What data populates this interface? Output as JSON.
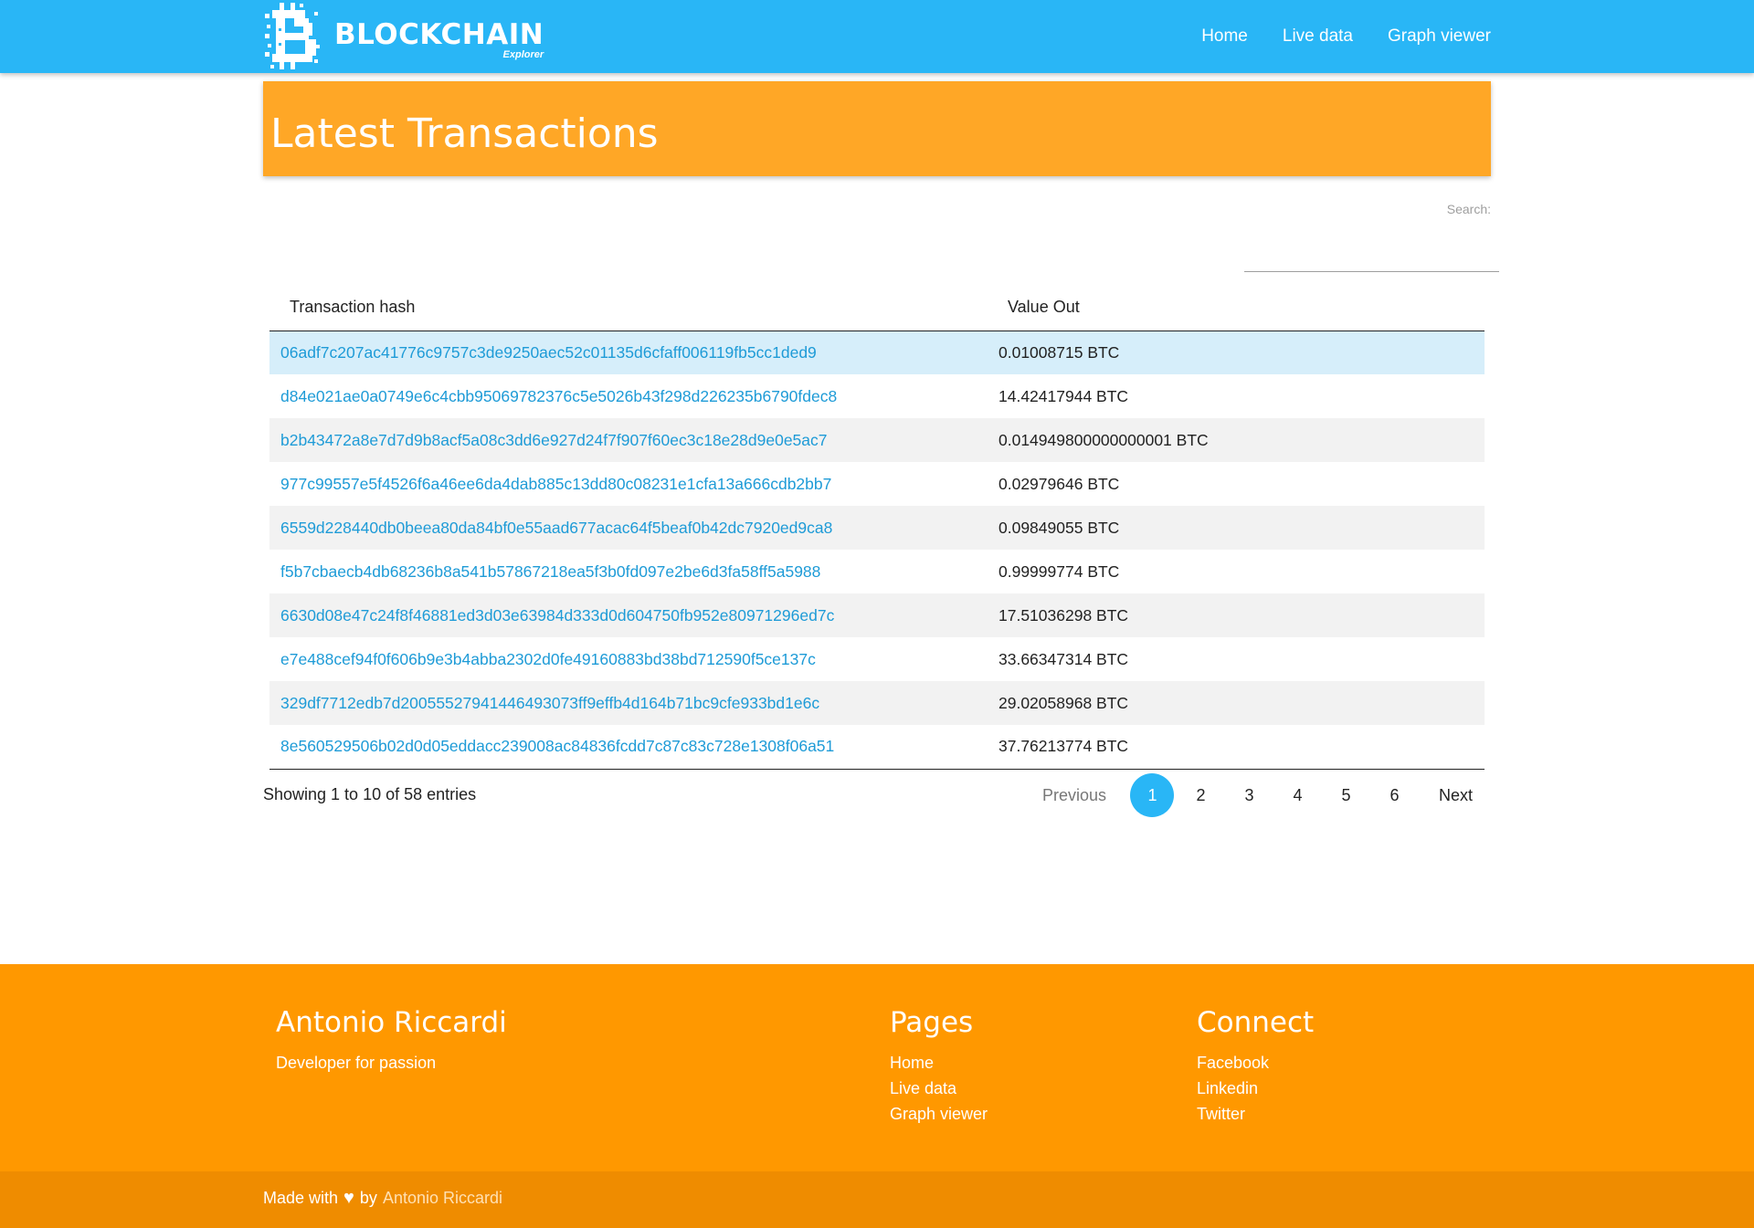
{
  "header": {
    "brand_title": "BLOCKCHAIN",
    "brand_subtitle": "Explorer",
    "nav": [
      "Home",
      "Live data",
      "Graph viewer"
    ]
  },
  "page": {
    "title": "Latest Transactions",
    "search_label": "Search:",
    "search_value": ""
  },
  "table": {
    "columns": [
      "Transaction hash",
      "Value Out"
    ],
    "rows": [
      {
        "hash": "06adf7c207ac41776c9757c3de9250aec52c01135d6cfaff006119fb5cc1ded9",
        "value": "0.01008715 BTC"
      },
      {
        "hash": "d84e021ae0a0749e6c4cbb95069782376c5e5026b43f298d226235b6790fdec8",
        "value": "14.42417944 BTC"
      },
      {
        "hash": "b2b43472a8e7d7d9b8acf5a08c3dd6e927d24f7f907f60ec3c18e28d9e0e5ac7",
        "value": "0.014949800000000001 BTC"
      },
      {
        "hash": "977c99557e5f4526f6a46ee6da4dab885c13dd80c08231e1cfa13a666cdb2bb7",
        "value": "0.02979646 BTC"
      },
      {
        "hash": "6559d228440db0beea80da84bf0e55aad677acac64f5beaf0b42dc7920ed9ca8",
        "value": "0.09849055 BTC"
      },
      {
        "hash": "f5b7cbaecb4db68236b8a541b57867218ea5f3b0fd097e2be6d3fa58ff5a5988",
        "value": "0.99999774 BTC"
      },
      {
        "hash": "6630d08e47c24f8f46881ed3d03e63984d333d0d604750fb952e80971296ed7c",
        "value": "17.51036298 BTC"
      },
      {
        "hash": "e7e488cef94f0f606b9e3b4abba2302d0fe49160883bd38bd712590f5ce137c",
        "value": "33.66347314 BTC"
      },
      {
        "hash": "329df7712edb7d20055527941446493073ff9effb4d164b71bc9cfe933bd1e6c",
        "value": "29.02058968 BTC"
      },
      {
        "hash": "8e560529506b02d0d05eddacc239008ac84836fcdd7c87c83c728e1308f06a51",
        "value": "37.76213774 BTC"
      }
    ],
    "info": "Showing 1 to 10 of 58 entries"
  },
  "pagination": {
    "previous": "Previous",
    "pages": [
      "1",
      "2",
      "3",
      "4",
      "5",
      "6"
    ],
    "active": "1",
    "next": "Next"
  },
  "footer": {
    "author_heading": "Antonio Riccardi",
    "author_tagline": "Developer for passion",
    "pages_heading": "Pages",
    "pages_links": [
      "Home",
      "Live data",
      "Graph viewer"
    ],
    "connect_heading": "Connect",
    "connect_links": [
      "Facebook",
      "Linkedin",
      "Twitter"
    ],
    "made_with": "Made with",
    "by": "by",
    "author_link": "Antonio Riccardi"
  },
  "colors": {
    "header": "#29b6f6",
    "title_card": "#ffa726",
    "footer": "#ff9800",
    "copyright": "#ef8c00",
    "link": "#1e9bd7"
  },
  "icons": {
    "logo": "blockchain-logo-icon",
    "heart": "heart-icon"
  }
}
